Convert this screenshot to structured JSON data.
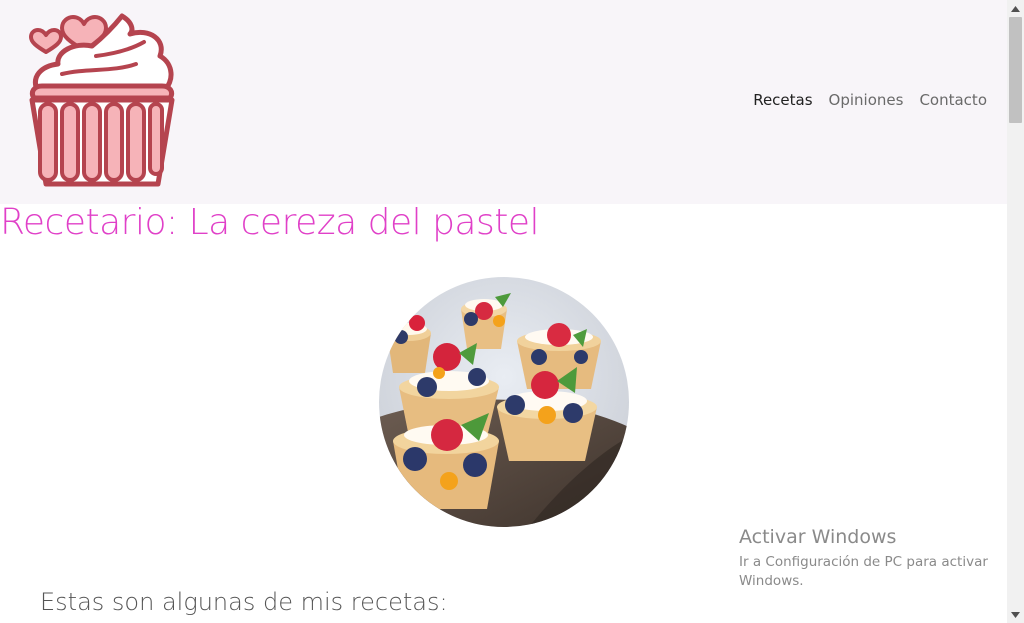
{
  "nav": {
    "links": [
      {
        "label": "Recetas"
      },
      {
        "label": "Opiniones"
      },
      {
        "label": "Contacto"
      }
    ]
  },
  "hero": {
    "title": "Recetario: La cereza del pastel",
    "image_alt": "fruit-tartlets-photo"
  },
  "section": {
    "heading": "Estas son algunas de mis recetas:"
  },
  "windows_watermark": {
    "title": "Activar Windows",
    "subtitle": "Ir a Configuración de PC para activar Windows."
  },
  "colors": {
    "title": "#e040c8",
    "navbar_bg": "#f8f5f9",
    "logo_stroke": "#b5444f",
    "logo_fill": "#f6b3b8"
  },
  "icons": {
    "logo": "cupcake-hearts-logo",
    "scroll_up": "scroll-up-arrow-icon",
    "scroll_down": "scroll-down-arrow-icon"
  }
}
